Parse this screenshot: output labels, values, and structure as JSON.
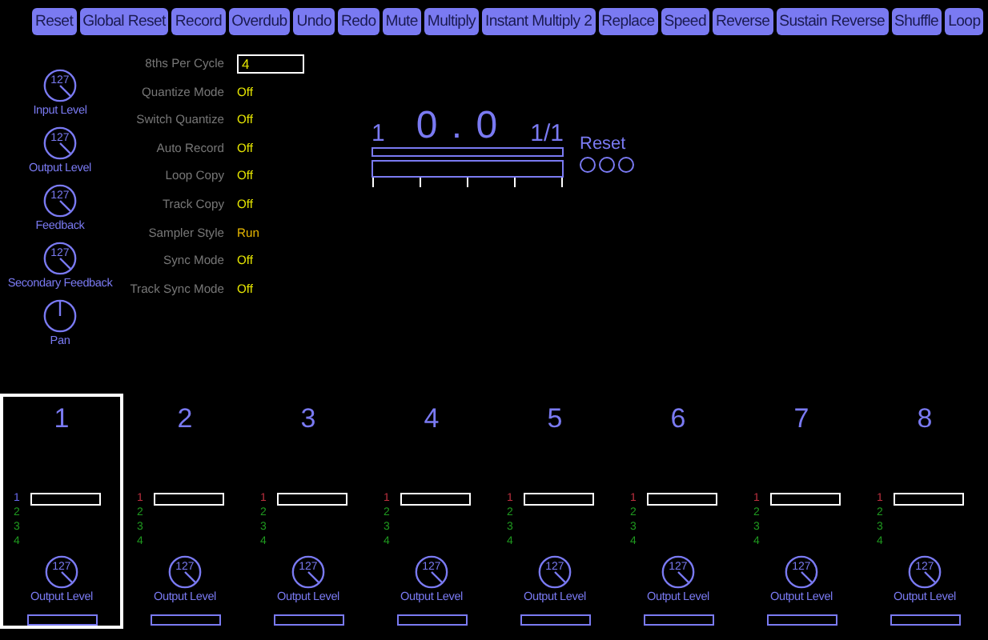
{
  "toolbar": {
    "buttons": [
      "Reset",
      "Global Reset",
      "Record",
      "Overdub",
      "Undo",
      "Redo",
      "Mute",
      "Multiply",
      "Instant Multiply 2",
      "Replace",
      "Speed",
      "Reverse",
      "Sustain Reverse",
      "Shuffle",
      "Loop"
    ]
  },
  "controls": {
    "knobs": [
      {
        "label": "Input Level",
        "value": "127"
      },
      {
        "label": "Output Level",
        "value": "127"
      },
      {
        "label": "Feedback",
        "value": "127"
      },
      {
        "label": "Secondary Feedback",
        "value": "127"
      },
      {
        "label": "Pan"
      }
    ],
    "parameters": [
      {
        "label": "8ths Per Cycle",
        "value": "4",
        "kind": "field"
      },
      {
        "label": "Quantize Mode",
        "value": "Off",
        "kind": "text"
      },
      {
        "label": "Switch Quantize",
        "value": "Off",
        "kind": "text"
      },
      {
        "label": "Auto Record",
        "value": "Off",
        "kind": "text"
      },
      {
        "label": "Loop Copy",
        "value": "Off",
        "kind": "text"
      },
      {
        "label": "Track Copy",
        "value": "Off",
        "kind": "text"
      },
      {
        "label": "Sampler Style",
        "value": "Run",
        "kind": "text"
      },
      {
        "label": "Sync Mode",
        "value": "Off",
        "kind": "text"
      },
      {
        "label": "Track Sync Mode",
        "value": "Off",
        "kind": "text"
      }
    ]
  },
  "display": {
    "loop_number": "1",
    "time": "0 . 0",
    "cycle": "1/1",
    "reset_label": "Reset",
    "loop_bar": {
      "level": 0
    },
    "cycle_bar": {
      "level": 0
    }
  },
  "tracks": [
    {
      "number": "1",
      "selected": true,
      "loops": [
        {
          "label": "1",
          "color": "#6a6af0"
        },
        {
          "label": "2",
          "color": "#1f9a1f"
        },
        {
          "label": "3",
          "color": "#1f9a1f"
        },
        {
          "label": "4",
          "color": "#1f9a1f"
        }
      ],
      "loop_bar": {
        "level": 0
      },
      "knob": {
        "value": "127",
        "label": "Output Level"
      },
      "meter": {
        "level": 0
      }
    },
    {
      "number": "2",
      "selected": false,
      "loops": [
        {
          "label": "1",
          "color": "#c03040"
        },
        {
          "label": "2",
          "color": "#1f9a1f"
        },
        {
          "label": "3",
          "color": "#1f9a1f"
        },
        {
          "label": "4",
          "color": "#1f9a1f"
        }
      ],
      "loop_bar": {
        "level": 0
      },
      "knob": {
        "value": "127",
        "label": "Output Level"
      },
      "meter": {
        "level": 0
      }
    },
    {
      "number": "3",
      "selected": false,
      "loops": [
        {
          "label": "1",
          "color": "#c03040"
        },
        {
          "label": "2",
          "color": "#1f9a1f"
        },
        {
          "label": "3",
          "color": "#1f9a1f"
        },
        {
          "label": "4",
          "color": "#1f9a1f"
        }
      ],
      "loop_bar": {
        "level": 0
      },
      "knob": {
        "value": "127",
        "label": "Output Level"
      },
      "meter": {
        "level": 0
      }
    },
    {
      "number": "4",
      "selected": false,
      "loops": [
        {
          "label": "1",
          "color": "#c03040"
        },
        {
          "label": "2",
          "color": "#1f9a1f"
        },
        {
          "label": "3",
          "color": "#1f9a1f"
        },
        {
          "label": "4",
          "color": "#1f9a1f"
        }
      ],
      "loop_bar": {
        "level": 0
      },
      "knob": {
        "value": "127",
        "label": "Output Level"
      },
      "meter": {
        "level": 0
      }
    },
    {
      "number": "5",
      "selected": false,
      "loops": [
        {
          "label": "1",
          "color": "#c03040"
        },
        {
          "label": "2",
          "color": "#1f9a1f"
        },
        {
          "label": "3",
          "color": "#1f9a1f"
        },
        {
          "label": "4",
          "color": "#1f9a1f"
        }
      ],
      "loop_bar": {
        "level": 0
      },
      "knob": {
        "value": "127",
        "label": "Output Level"
      },
      "meter": {
        "level": 0
      }
    },
    {
      "number": "6",
      "selected": false,
      "loops": [
        {
          "label": "1",
          "color": "#c03040"
        },
        {
          "label": "2",
          "color": "#1f9a1f"
        },
        {
          "label": "3",
          "color": "#1f9a1f"
        },
        {
          "label": "4",
          "color": "#1f9a1f"
        }
      ],
      "loop_bar": {
        "level": 0
      },
      "knob": {
        "value": "127",
        "label": "Output Level"
      },
      "meter": {
        "level": 0
      }
    },
    {
      "number": "7",
      "selected": false,
      "loops": [
        {
          "label": "1",
          "color": "#c03040"
        },
        {
          "label": "2",
          "color": "#1f9a1f"
        },
        {
          "label": "3",
          "color": "#1f9a1f"
        },
        {
          "label": "4",
          "color": "#1f9a1f"
        }
      ],
      "loop_bar": {
        "level": 0
      },
      "knob": {
        "value": "127",
        "label": "Output Level"
      },
      "meter": {
        "level": 0
      }
    },
    {
      "number": "8",
      "selected": false,
      "loops": [
        {
          "label": "1",
          "color": "#c03040"
        },
        {
          "label": "2",
          "color": "#1f9a1f"
        },
        {
          "label": "3",
          "color": "#1f9a1f"
        },
        {
          "label": "4",
          "color": "#1f9a1f"
        }
      ],
      "loop_bar": {
        "level": 0
      },
      "knob": {
        "value": "127",
        "label": "Output Level"
      },
      "meter": {
        "level": 0
      }
    }
  ]
}
